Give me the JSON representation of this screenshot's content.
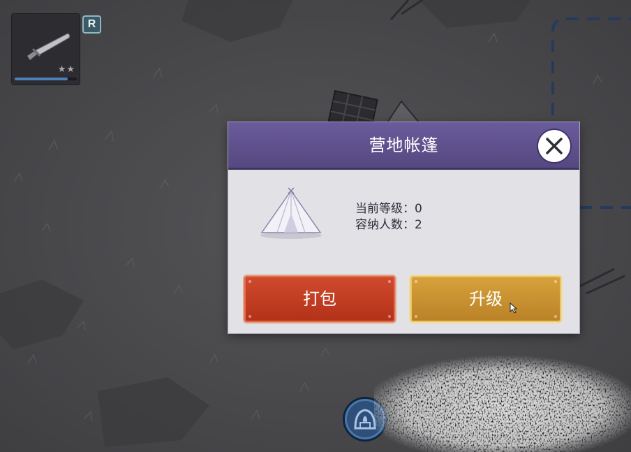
{
  "hud": {
    "weapon": {
      "icon": "knife-icon",
      "stars": "★★",
      "durability_fraction": 0.85
    },
    "rarity_badge": "R"
  },
  "dialog": {
    "title": "营地帐篷",
    "image_icon": "tent-icon",
    "level_line": "当前等级：0",
    "capacity_line": "容纳人数：2",
    "pack_label": "打包",
    "upgrade_label": "升级",
    "close_icon": "close-icon"
  },
  "bottom": {
    "campfire_icon": "campfire-icon"
  },
  "colors": {
    "header": "#5e5090",
    "dialog_bg": "#e2e1e6",
    "pack_button": "#c13d22",
    "upgrade_button": "#cf9933"
  }
}
